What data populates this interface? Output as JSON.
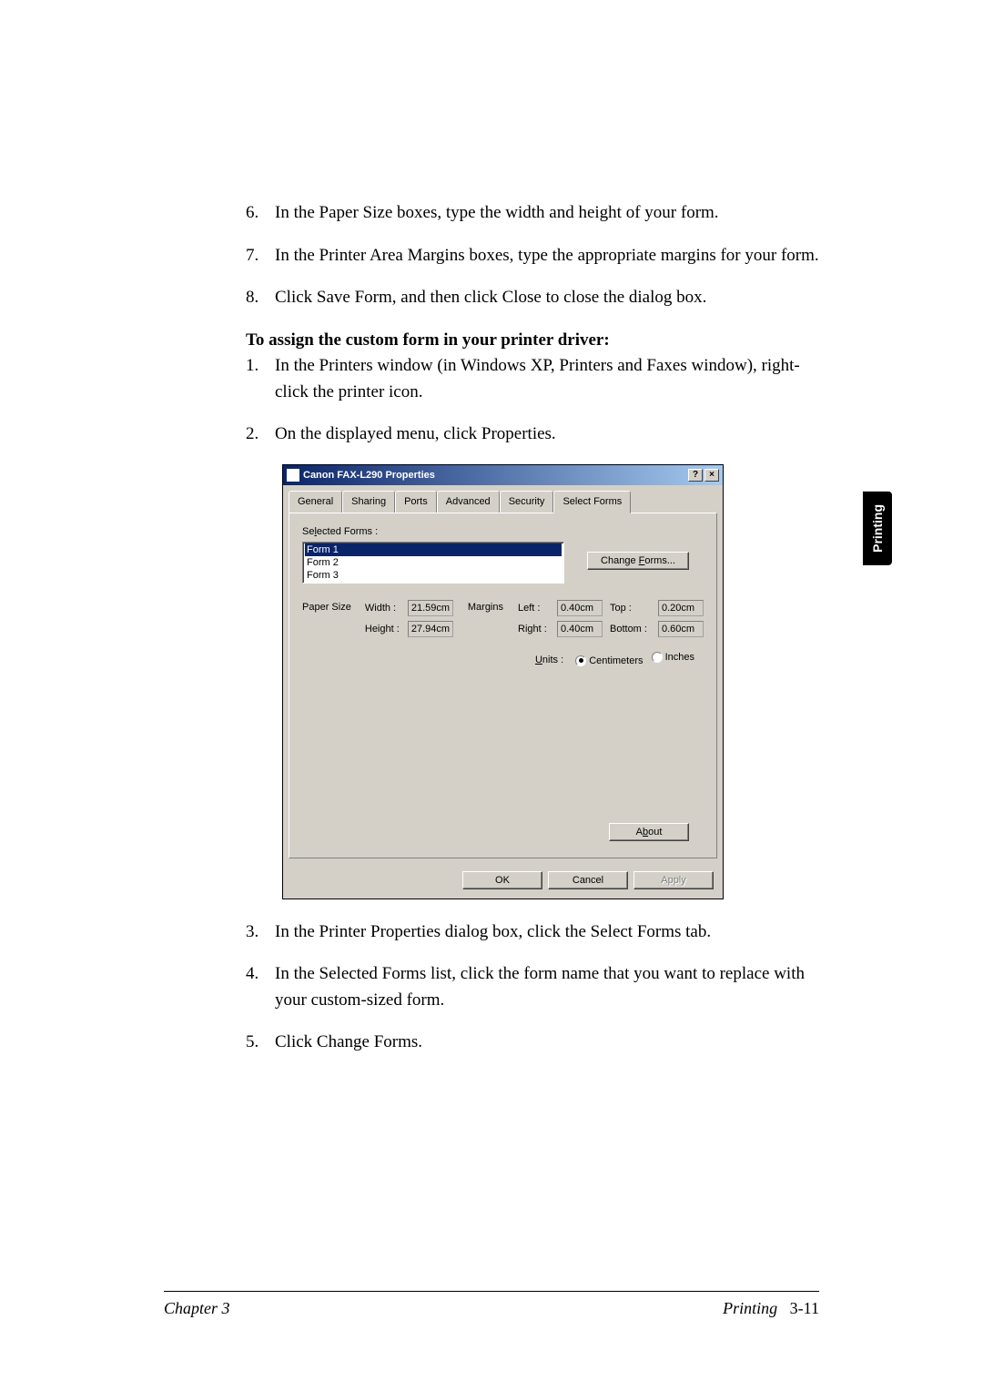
{
  "steps6": {
    "num": "6.",
    "text": "In the Paper Size boxes, type the width and height of your form."
  },
  "steps7": {
    "num": "7.",
    "text": "In the Printer Area Margins boxes, type the appropriate margins for your form."
  },
  "steps8": {
    "num": "8.",
    "text": "Click Save Form, and then click Close to close the dialog box."
  },
  "heading": "To assign the custom form in your printer driver:",
  "steps1": {
    "num": "1.",
    "text": "In the Printers window (in Windows XP, Printers and Faxes window), right-click the printer icon."
  },
  "steps2": {
    "num": "2.",
    "text": "On the displayed menu, click Properties."
  },
  "steps3": {
    "num": "3.",
    "text": "In the Printer Properties dialog box, click the Select Forms tab."
  },
  "steps4": {
    "num": "4.",
    "text": "In the Selected Forms list, click the form name that you want to replace with your custom-sized form."
  },
  "steps5": {
    "num": "5.",
    "text": "Click Change Forms."
  },
  "dialog": {
    "title": "Canon FAX-L290 Properties",
    "help": "?",
    "close": "×",
    "tabs": [
      "General",
      "Sharing",
      "Ports",
      "Advanced",
      "Security",
      "Select Forms"
    ],
    "selectedFormsLabel": "Selected Forms :",
    "forms": [
      "Form 1",
      "Form 2",
      "Form 3"
    ],
    "changeForms": "Change Forms...",
    "paperSize": "Paper Size",
    "widthLabel": "Width :",
    "widthVal": "21.59cm",
    "heightLabel": "Height :",
    "heightVal": "27.94cm",
    "marginsLabel": "Margins",
    "leftLabel": "Left :",
    "leftVal": "0.40cm",
    "rightLabel": "Right :",
    "rightVal": "0.40cm",
    "topLabel": "Top :",
    "topVal": "0.20cm",
    "bottomLabel": "Bottom :",
    "bottomVal": "0.60cm",
    "unitsLabel": "Units :",
    "unitCm": "Centimeters",
    "unitIn": "Inches",
    "about": "About",
    "ok": "OK",
    "cancel": "Cancel",
    "apply": "Apply"
  },
  "sideTab": "Printing",
  "footer": {
    "left": "Chapter 3",
    "rightLabel": "Printing",
    "rightPage": "3-11"
  }
}
